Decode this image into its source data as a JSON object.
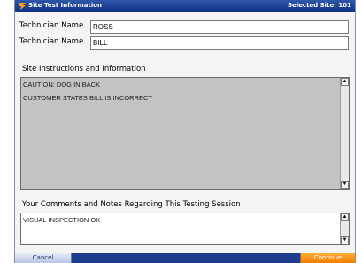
{
  "titlebar": {
    "title": "Site Test Information",
    "selected_site": "Selected Site: 101"
  },
  "technicians": [
    {
      "label": "Technician Name",
      "value": "ROSS"
    },
    {
      "label": "Technician Name",
      "value": "BILL"
    }
  ],
  "instructions": {
    "label": "Site Instructions and Information",
    "lines": [
      "CAUTION: DOG IN BACK",
      "CUSTOMER STATES BILL IS INCORRECT"
    ]
  },
  "comments": {
    "label": "Your Comments and Notes Regarding This Testing Session",
    "value": "VISUAL INSPECTION OK"
  },
  "buttons": {
    "cancel": "Cancel",
    "continue": "Continue"
  },
  "colors": {
    "titlebar": "#1e3d8f",
    "instructions_bg": "#c3c3c3",
    "continue_button": "#f07f00"
  },
  "icons": {
    "scroll_up": "scroll-up-arrow-icon",
    "scroll_down": "scroll-down-arrow-icon",
    "logo": "app-logo-icon"
  }
}
